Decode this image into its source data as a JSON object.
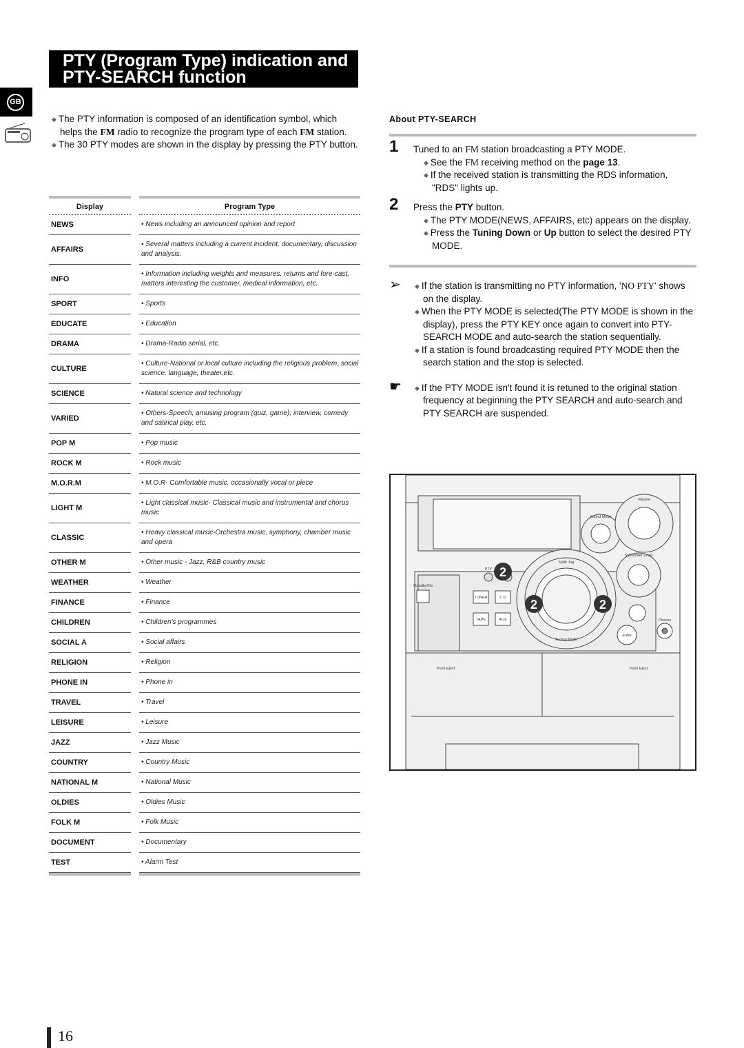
{
  "title": {
    "line1": "PTY (Program Type) indication and",
    "line2": "PTY-SEARCH function"
  },
  "lang_badge": "GB",
  "intro": {
    "b1": [
      "The PTY information is composed of an identification symbol, which helps the ",
      "FM",
      " radio to recognize the program type of each ",
      "FM",
      " station."
    ],
    "b2": "The 30 PTY modes are shown in the display by pressing the PTY button."
  },
  "table": {
    "headers": [
      "Display",
      "Program Type"
    ],
    "rows": [
      [
        "NEWS",
        "• News including an announced opinion and report",
        0
      ],
      [
        "AFFAIRS",
        "• Several matters including a current incident, documentary, discussion and analysis.",
        1
      ],
      [
        "INFO",
        "• Information including weights and measures, returns and fore-cast, matters interesting the customer, medical information, etc.",
        1
      ],
      [
        "SPORT",
        "• Sports",
        0
      ],
      [
        "EDUCATE",
        "• Education",
        0
      ],
      [
        "DRAMA",
        "• Drama-Radio serial, etc.",
        0
      ],
      [
        "CULTURE",
        "• Culture-National or local culture including the religious problem, social science, language, theater,etc.",
        1
      ],
      [
        "SCIENCE",
        "• Natural science and technology",
        0
      ],
      [
        "VARIED",
        "• Others-Speech, amusing program (quiz, game), interview, comedy and satirical play, etc.",
        1
      ],
      [
        "POP M",
        "• Pop music",
        0
      ],
      [
        "ROCK M",
        "• Rock music",
        0
      ],
      [
        "M.O.R.M",
        "• M.O.R- Comfortable music, occasionally vocal or piece",
        0
      ],
      [
        "LIGHT M",
        "• Light classical music- Classical music and instrumental and chorus music",
        1
      ],
      [
        "CLASSIC",
        "• Heavy classical  music-Orchestra music, symphony, chamber music and opera",
        1
      ],
      [
        "OTHER M",
        "• Other music - Jazz, R&B country music",
        0
      ],
      [
        "WEATHER",
        "• Weather",
        0
      ],
      [
        "FINANCE",
        "• Finance",
        0
      ],
      [
        "CHILDREN",
        "• Children's programmes",
        0
      ],
      [
        "SOCIAL  A",
        "• Social affairs",
        0
      ],
      [
        "RELIGION",
        "• Religion",
        0
      ],
      [
        "PHONE IN",
        "• Phone in",
        0
      ],
      [
        "TRAVEL",
        "• Travel",
        0
      ],
      [
        "LEISURE",
        "• Leisure",
        0
      ],
      [
        "JAZZ",
        "• Jazz Music",
        0
      ],
      [
        "COUNTRY",
        "• Country Music",
        0
      ],
      [
        "NATIONAL M",
        "• National Music",
        0
      ],
      [
        "OLDIES",
        "• Oldies Music",
        0
      ],
      [
        "FOLK M",
        "• Folk Music",
        0
      ],
      [
        "DOCUMENT",
        "• Documentary",
        0
      ],
      [
        "TEST",
        "• Alarm Test",
        0
      ]
    ]
  },
  "about": {
    "heading": "About  PTY-SEARCH",
    "step1": {
      "num": "1",
      "text": [
        "Tuned to an ",
        "FM",
        " station broadcasting a PTY MODE."
      ],
      "b1": [
        "See the ",
        "FM",
        " receiving method on the ",
        "page 13",
        "."
      ],
      "b2": "If the received station is transmitting the RDS information, \"RDS\" lights up."
    },
    "step2": {
      "num": "2",
      "text": [
        "Press the ",
        "PTY",
        " button."
      ],
      "b1": "The PTY MODE(NEWS, AFFAIRS, etc) appears on the display.",
      "b2": [
        "Press the ",
        "Tuning Down",
        " or ",
        "Up",
        " button to select the desired PTY MODE."
      ]
    },
    "note1": {
      "icon": "arrow-pointer-icon",
      "b1": [
        "If the station is transmitting no PTY information, '",
        "NO PTY",
        "' shows on the display."
      ],
      "b2": "When the PTY MODE is selected(The PTY MODE is shown in the display), press the PTY KEY once again to convert into PTY-SEARCH MODE and auto-search the station sequentially.",
      "b3": "If a station is found broadcasting required PTY MODE then the search station and the stop is selected."
    },
    "note2": {
      "icon": "pointing-hand-icon",
      "b1": "If the PTY MODE isn't found it is retuned to the original station frequency at beginning the PTY SEARCH and auto-search and PTY SEARCH are suspended."
    }
  },
  "device": {
    "volume": "Volume",
    "sound_mode": "Sound Mode",
    "subwoofer": "Subwoofer Level",
    "pty": "PTY",
    "standby": "Standby/On",
    "tuner": "TUNER",
    "cd": "C D",
    "tape": "TAPE",
    "aux": "AUX",
    "enter": "Enter",
    "phones": "Phones",
    "multi_jog": "Multi Jog",
    "tuning_mode": "Tuning Mode",
    "push_eject_l": "Push Eject",
    "push_eject_r": "Push Eject",
    "callout": "2"
  },
  "page_number": "16"
}
